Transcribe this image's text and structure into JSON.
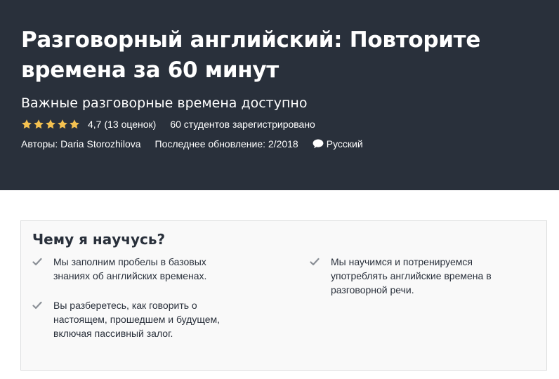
{
  "course": {
    "title": "Разговорный английский: Повторите времена за 60 минут",
    "subtitle": "Важные разговорные времена доступно",
    "rating": {
      "stars_filled": 5,
      "value": "4,7",
      "count_text": "(13 оценок)",
      "students_text": "60 студентов зарегистрировано"
    },
    "meta": {
      "authors_label": "Авторы:",
      "author_name": "Daria Storozhilova",
      "updated_text": "Последнее обновление: 2/2018",
      "language": "Русский"
    }
  },
  "learn": {
    "heading": "Чему я научусь?",
    "items": [
      "Мы заполним пробелы в базовых знаниях об английских временах.",
      "Мы научимся и потренируемся употреблять английские времена в разговорной речи.",
      "Вы разберетесь, как говорить о настоящем, прошедшем и будущем, включая пассивный залог."
    ]
  },
  "colors": {
    "hero_bg": "#29303b",
    "star": "#f4c150",
    "check": "#8a8f96",
    "box_bg": "#f9f9f9",
    "box_border": "#dedfe0"
  }
}
